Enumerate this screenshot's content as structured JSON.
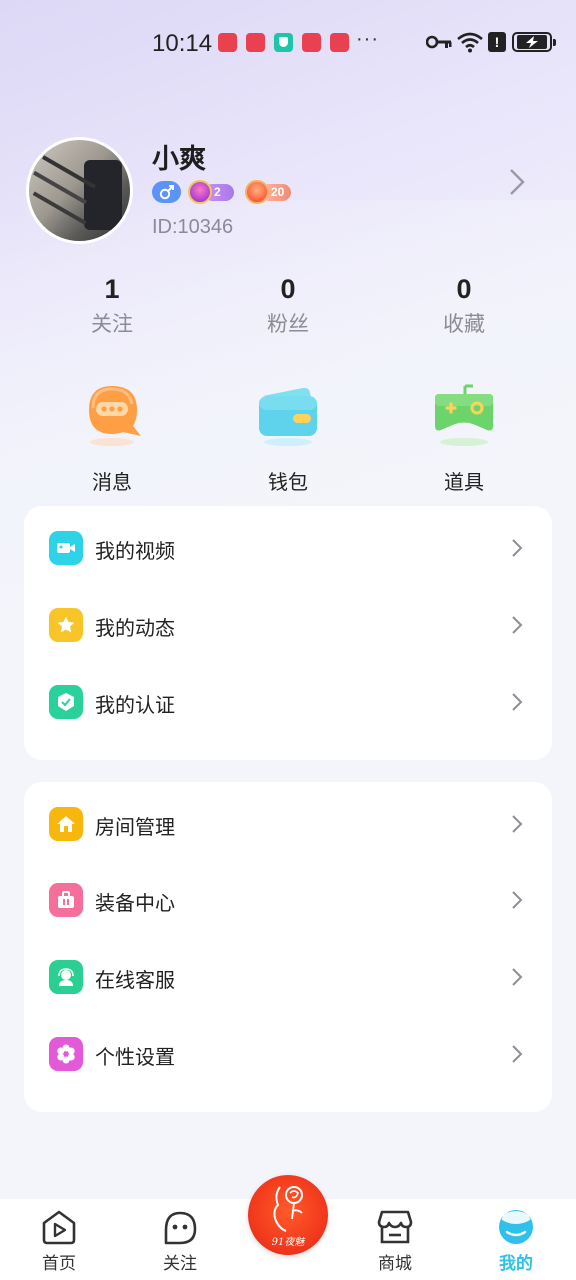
{
  "status_bar": {
    "time": "10:14",
    "more": "···"
  },
  "profile": {
    "name": "小爽",
    "gender": "male",
    "badges": [
      {
        "level": "2",
        "color": "#a977ea"
      },
      {
        "level": "20",
        "color": "#f28a73"
      }
    ],
    "id": "ID:10346"
  },
  "stats": [
    {
      "value": "1",
      "label": "关注"
    },
    {
      "value": "0",
      "label": "粉丝"
    },
    {
      "value": "0",
      "label": "收藏"
    }
  ],
  "quick_actions": [
    {
      "label": "消息",
      "icon": "chat-bubble-icon",
      "color": "#ff9a3d"
    },
    {
      "label": "钱包",
      "icon": "wallet-icon",
      "color": "#4fd0e8"
    },
    {
      "label": "道具",
      "icon": "gamepad-icon",
      "color": "#6cd46a"
    }
  ],
  "menu_group_1": [
    {
      "label": "我的视频",
      "icon": "video-camera-icon",
      "color": "#2fd3e8"
    },
    {
      "label": "我的动态",
      "icon": "star-icon",
      "color": "#f7c527"
    },
    {
      "label": "我的认证",
      "icon": "shield-check-icon",
      "color": "#2bd19a"
    }
  ],
  "menu_group_2": [
    {
      "label": "房间管理",
      "icon": "house-icon",
      "color": "#f7b70d"
    },
    {
      "label": "装备中心",
      "icon": "briefcase-icon",
      "color": "#f66f9b"
    },
    {
      "label": "在线客服",
      "icon": "support-agent-icon",
      "color": "#2ccf93"
    },
    {
      "label": "个性设置",
      "icon": "gear-flower-icon",
      "color": "#e35ad8"
    }
  ],
  "bottom_nav": [
    {
      "label": "首页",
      "icon": "home-play-icon",
      "active": false
    },
    {
      "label": "关注",
      "icon": "smiley-face-icon",
      "active": false
    },
    {
      "label": "商城",
      "icon": "store-icon",
      "active": false
    },
    {
      "label": "我的",
      "icon": "profile-bubble-icon",
      "active": true
    }
  ],
  "center_logo_text": "91夜魅",
  "colors": {
    "accent": "#2fc1ea",
    "logo_red": "#f23a1c"
  }
}
